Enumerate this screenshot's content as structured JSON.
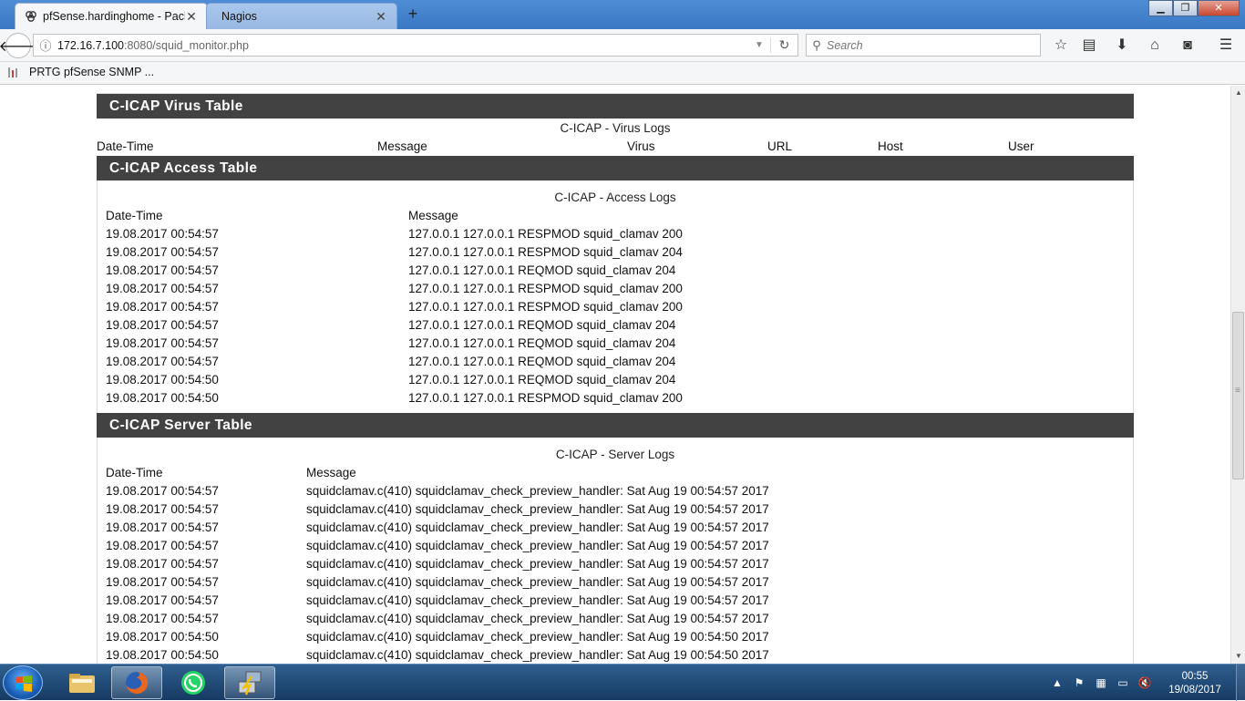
{
  "browser": {
    "tabs": [
      {
        "title": "pfSense.hardinghome - Package",
        "active": true
      },
      {
        "title": "Nagios",
        "active": false
      }
    ],
    "url_prefix": "172.16.7.100",
    "url_suffix": ":8080/squid_monitor.php",
    "search_placeholder": "Search",
    "bookmark": "PRTG pfSense SNMP ..."
  },
  "virus_section": {
    "header": "C-ICAP Virus Table",
    "caption": "C-ICAP - Virus Logs",
    "columns": [
      "Date-Time",
      "Message",
      "Virus",
      "URL",
      "Host",
      "User"
    ]
  },
  "access_section": {
    "header": "C-ICAP Access Table",
    "caption": "C-ICAP - Access Logs",
    "columns": [
      "Date-Time",
      "Message"
    ],
    "rows": [
      [
        "19.08.2017 00:54:57",
        "127.0.0.1 127.0.0.1 RESPMOD squid_clamav 200"
      ],
      [
        "19.08.2017 00:54:57",
        "127.0.0.1 127.0.0.1 RESPMOD squid_clamav 204"
      ],
      [
        "19.08.2017 00:54:57",
        "127.0.0.1 127.0.0.1 REQMOD squid_clamav 204"
      ],
      [
        "19.08.2017 00:54:57",
        "127.0.0.1 127.0.0.1 RESPMOD squid_clamav 200"
      ],
      [
        "19.08.2017 00:54:57",
        "127.0.0.1 127.0.0.1 RESPMOD squid_clamav 200"
      ],
      [
        "19.08.2017 00:54:57",
        "127.0.0.1 127.0.0.1 REQMOD squid_clamav 204"
      ],
      [
        "19.08.2017 00:54:57",
        "127.0.0.1 127.0.0.1 REQMOD squid_clamav 204"
      ],
      [
        "19.08.2017 00:54:57",
        "127.0.0.1 127.0.0.1 REQMOD squid_clamav 204"
      ],
      [
        "19.08.2017 00:54:50",
        "127.0.0.1 127.0.0.1 REQMOD squid_clamav 204"
      ],
      [
        "19.08.2017 00:54:50",
        "127.0.0.1 127.0.0.1 RESPMOD squid_clamav 200"
      ]
    ]
  },
  "server_section": {
    "header": "C-ICAP Server Table",
    "caption": "C-ICAP - Server Logs",
    "columns": [
      "Date-Time",
      "Message"
    ],
    "rows": [
      [
        "19.08.2017 00:54:57",
        "squidclamav.c(410) squidclamav_check_preview_handler: Sat Aug 19 00:54:57 2017"
      ],
      [
        "19.08.2017 00:54:57",
        "squidclamav.c(410) squidclamav_check_preview_handler: Sat Aug 19 00:54:57 2017"
      ],
      [
        "19.08.2017 00:54:57",
        "squidclamav.c(410) squidclamav_check_preview_handler: Sat Aug 19 00:54:57 2017"
      ],
      [
        "19.08.2017 00:54:57",
        "squidclamav.c(410) squidclamav_check_preview_handler: Sat Aug 19 00:54:57 2017"
      ],
      [
        "19.08.2017 00:54:57",
        "squidclamav.c(410) squidclamav_check_preview_handler: Sat Aug 19 00:54:57 2017"
      ],
      [
        "19.08.2017 00:54:57",
        "squidclamav.c(410) squidclamav_check_preview_handler: Sat Aug 19 00:54:57 2017"
      ],
      [
        "19.08.2017 00:54:57",
        "squidclamav.c(410) squidclamav_check_preview_handler: Sat Aug 19 00:54:57 2017"
      ],
      [
        "19.08.2017 00:54:57",
        "squidclamav.c(410) squidclamav_check_preview_handler: Sat Aug 19 00:54:57 2017"
      ],
      [
        "19.08.2017 00:54:50",
        "squidclamav.c(410) squidclamav_check_preview_handler: Sat Aug 19 00:54:50 2017"
      ],
      [
        "19.08.2017 00:54:50",
        "squidclamav.c(410) squidclamav_check_preview_handler: Sat Aug 19 00:54:50 2017"
      ]
    ]
  },
  "taskbar": {
    "clock_time": "00:55",
    "clock_date": "19/08/2017"
  },
  "colors": {
    "section_header_bg": "#424242",
    "titlebar_blue": "#3a77c4"
  }
}
